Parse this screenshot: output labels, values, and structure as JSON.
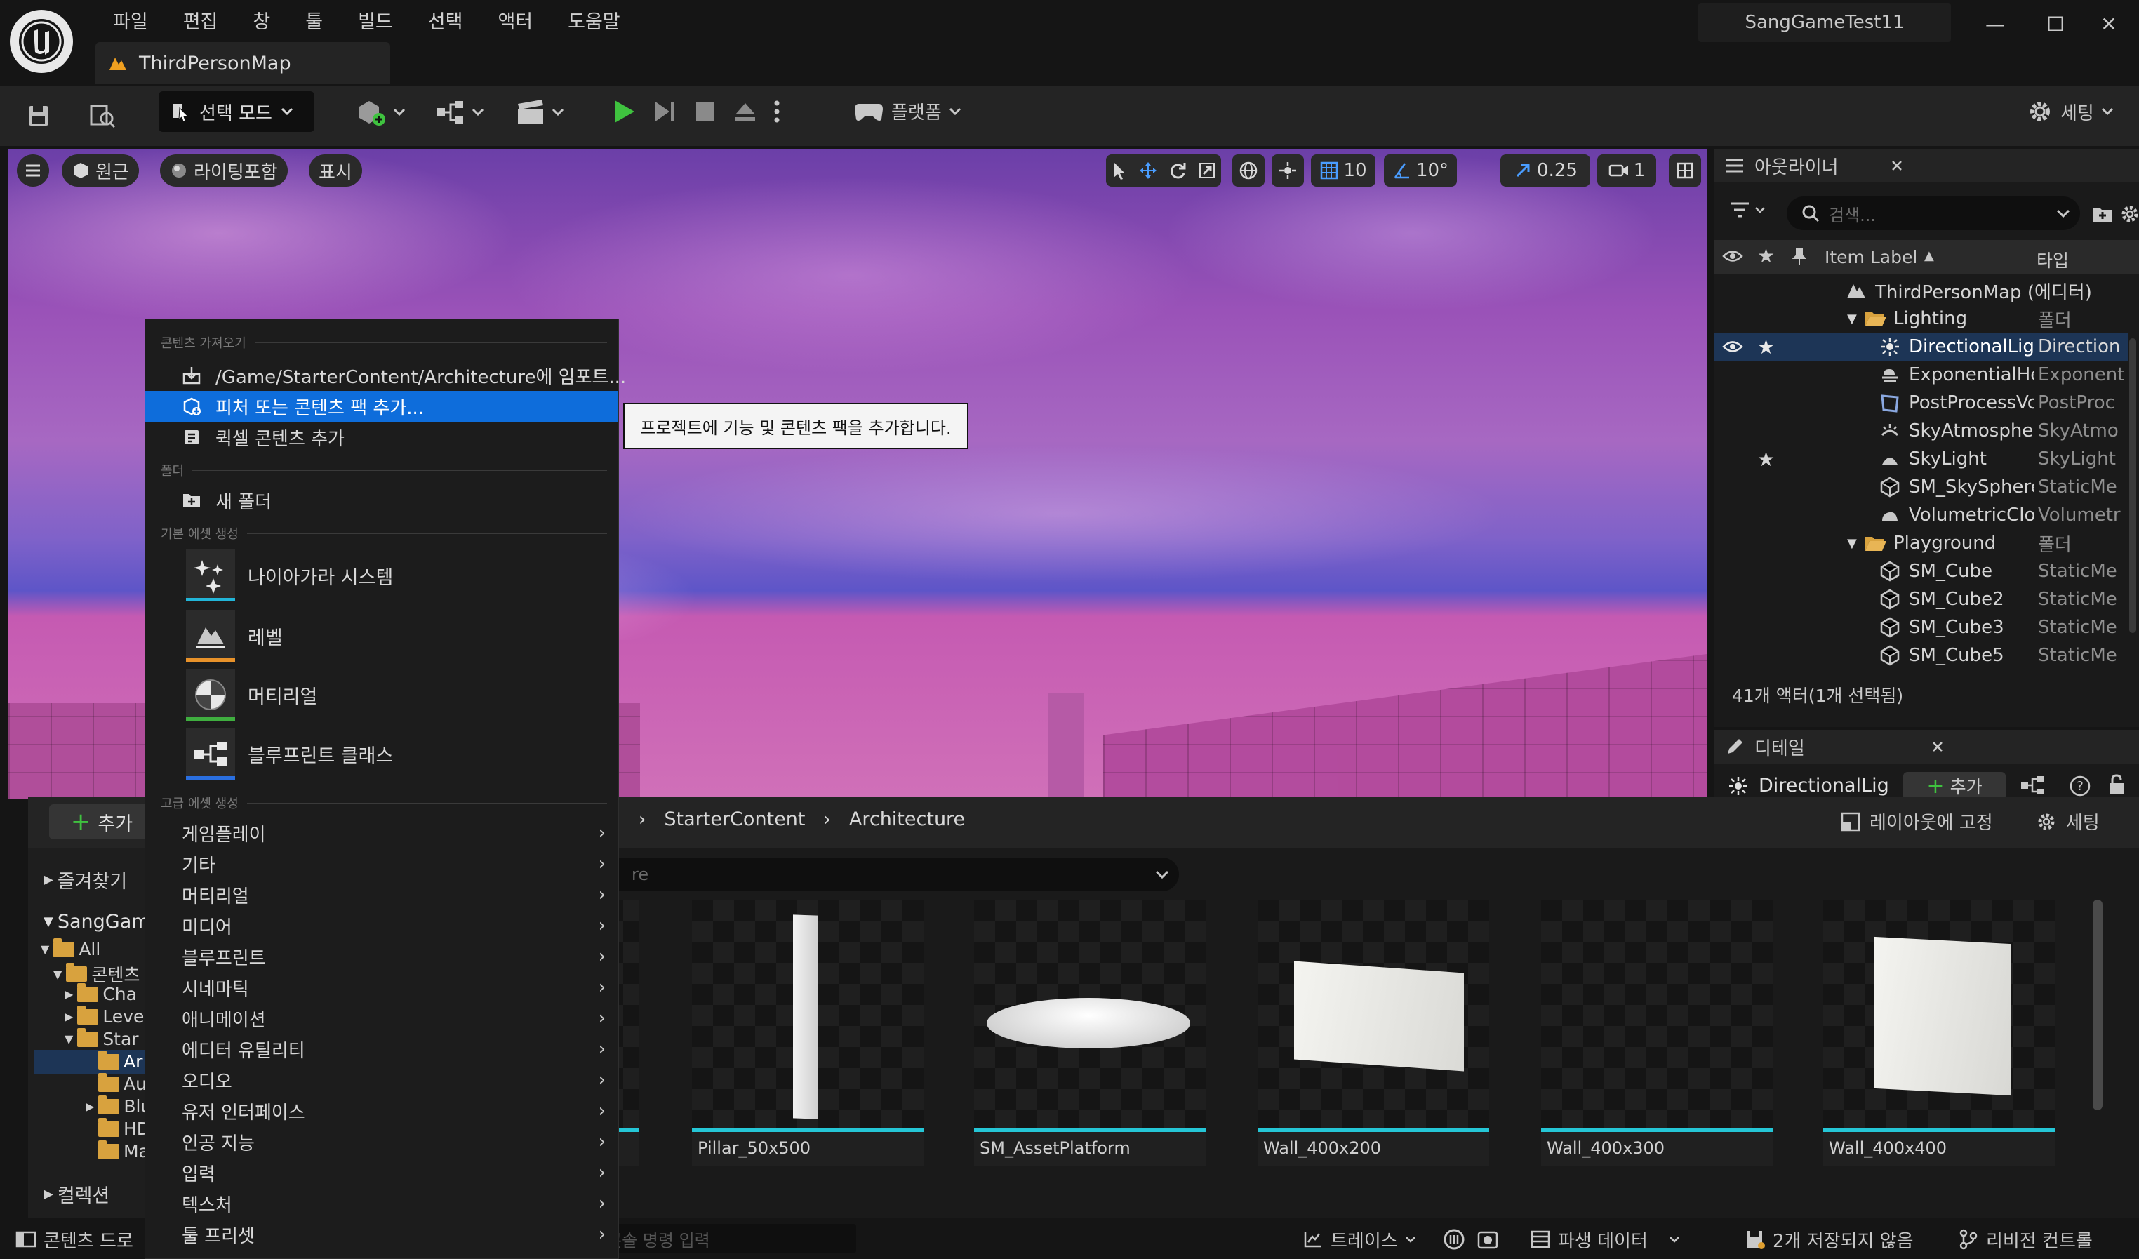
{
  "menubar": [
    "파일",
    "편집",
    "창",
    "툴",
    "빌드",
    "선택",
    "액터",
    "도움말"
  ],
  "project_name": "SangGameTest11",
  "window": {
    "minimize": "—",
    "maximize": "☐",
    "close": "✕"
  },
  "map_tab": "ThirdPersonMap",
  "toolbar": {
    "select_mode": "선택 모드",
    "platform": "플랫폼",
    "settings": "세팅"
  },
  "viewport": {
    "perspective": "원근",
    "lighting": "라이팅포함",
    "show": "표시",
    "grid_snap": "10",
    "rotation_snap": "10°",
    "scale_snap": "0.25",
    "camera_speed": "1"
  },
  "outliner": {
    "title": "아웃라이너",
    "search_placeholder": "검색...",
    "col_label": "Item Label",
    "col_label_sort": "▲",
    "col_type": "타입",
    "rows": [
      {
        "label": "ThirdPersonMap (에디터)",
        "type": ""
      },
      {
        "label": "Lighting",
        "type": "폴더"
      },
      {
        "label": "DirectionalLight",
        "type": "Direction"
      },
      {
        "label": "ExponentialHeightFog",
        "type": "Exponent"
      },
      {
        "label": "PostProcessVolume",
        "type": "PostProc"
      },
      {
        "label": "SkyAtmosphere",
        "type": "SkyAtmo"
      },
      {
        "label": "SkyLight",
        "type": "SkyLight"
      },
      {
        "label": "SM_SkySphere",
        "type": "StaticMe"
      },
      {
        "label": "VolumetricCloud",
        "type": "Volumetr"
      },
      {
        "label": "Playground",
        "type": "폴더"
      },
      {
        "label": "SM_Cube",
        "type": "StaticMe"
      },
      {
        "label": "SM_Cube2",
        "type": "StaticMe"
      },
      {
        "label": "SM_Cube3",
        "type": "StaticMe"
      },
      {
        "label": "SM_Cube5",
        "type": "StaticMe"
      }
    ],
    "count": "41개 액터(1개 선택됨)"
  },
  "details": {
    "title": "디테일",
    "actor": "DirectionalLig",
    "add": "추가"
  },
  "content_browser": {
    "add": "추가",
    "favorites": "즐겨찾기",
    "project": "SangGam",
    "breadcrumb": [
      "StarterContent",
      "Architecture"
    ],
    "filter_text": "re",
    "lock_layout": "레이아웃에 고정",
    "settings": "세팅",
    "tree": [
      "All",
      "콘텐츠",
      "Cha",
      "Leve",
      "Star",
      "Ar",
      "Au",
      "Blu",
      "HD",
      "Ma"
    ],
    "collections": "컬렉션",
    "assets": [
      "Pillar_50x500",
      "SM_AssetPlatform",
      "Wall_400x200",
      "Wall_400x300",
      "Wall_400x400"
    ]
  },
  "statusbar": {
    "content_drawer": "콘텐츠 드로",
    "console_placeholder": "콘솔 명령 입력",
    "trace": "트레이스",
    "derived_data": "파생 데이터",
    "unsaved": "2개 저장되지 않음",
    "revision_control": "리비전 컨트롤"
  },
  "context_menu": {
    "section_import": "콘텐츠 가져오기",
    "import_path": "/Game/StarterContent/Architecture에 임포트...",
    "add_feature_pack": "피처 또는 콘텐츠 팩 추가...",
    "add_quixel": "퀵셀 콘텐츠 추가",
    "section_folder": "폴더",
    "new_folder": "새 폴더",
    "section_basic": "기본 에셋 생성",
    "basic_assets": [
      "나이아가라 시스템",
      "레벨",
      "머티리얼",
      "블루프린트 클래스"
    ],
    "section_advanced": "고급 에셋 생성",
    "advanced": [
      "게임플레이",
      "기타",
      "머티리얼",
      "미디어",
      "블루프린트",
      "시네마틱",
      "애니메이션",
      "에디터 유틸리티",
      "오디오",
      "유저 인터페이스",
      "인공 지능",
      "입력",
      "텍스처",
      "툴 프리셋"
    ]
  },
  "tooltip": "프로젝트에 기능 및 콘텐츠 팩을 추가합니다.",
  "colors": {
    "accent": "#0e6ddb",
    "play_green": "#3fc23f",
    "asset_underline": "#25c6d6"
  }
}
